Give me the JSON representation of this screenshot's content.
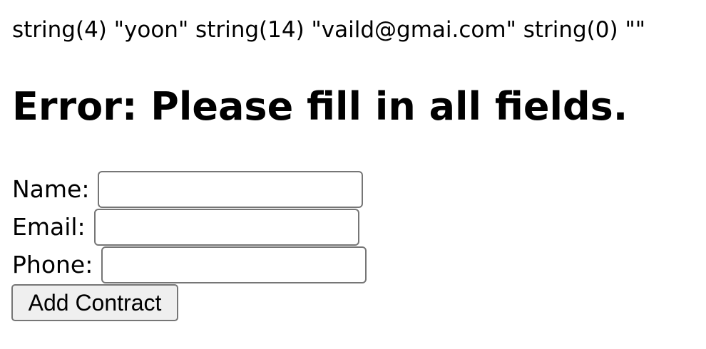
{
  "debug_output": "string(4) \"yoon\" string(14) \"vaild@gmai.com\" string(0) \"\"",
  "error_message": "Error: Please fill in all fields.",
  "form": {
    "name_label": "Name:",
    "name_value": "",
    "email_label": "Email:",
    "email_value": "",
    "phone_label": "Phone:",
    "phone_value": "",
    "submit_label": "Add Contract"
  }
}
